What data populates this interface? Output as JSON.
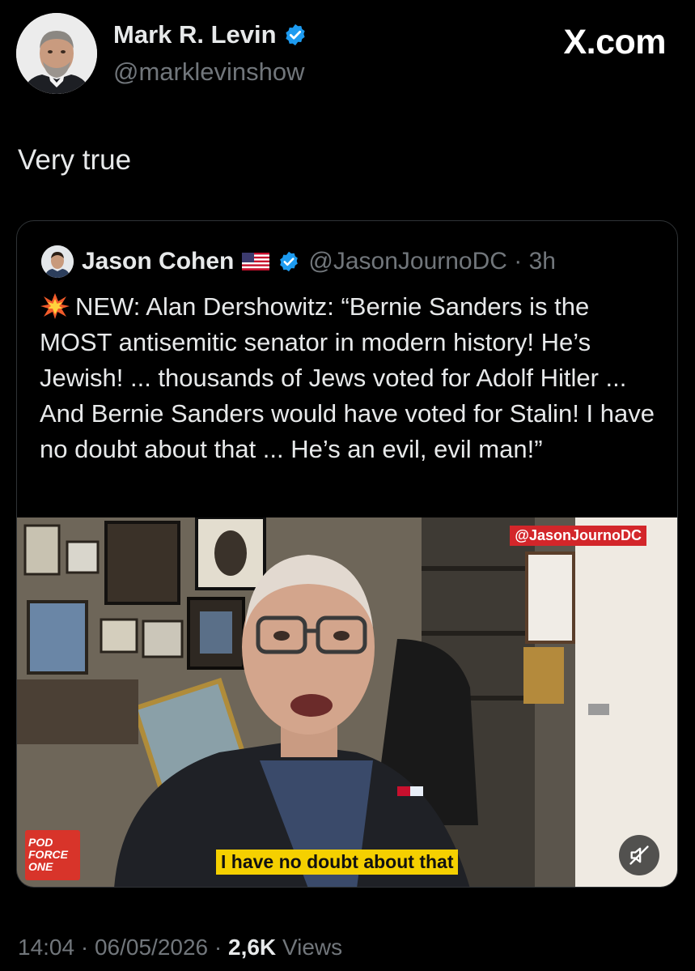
{
  "author": {
    "name": "Mark R. Levin",
    "handle": "@marklevinshow",
    "verified": true
  },
  "brand": "X.com",
  "tweet": {
    "text": "Very true"
  },
  "quote": {
    "author_name": "Jason Cohen",
    "flag": "US flag",
    "handle": "@JasonJournoDC",
    "time": "3h",
    "emoji": "collision-emoji",
    "body": "NEW: Alan Dershowitz: “Bernie Sanders is the MOST antisemitic senator in modern history! He’s Jewish! ... thousands of Jews voted for Adolf Hitler ... And Bernie Sanders would have voted for Stalin! I have no doubt about that ... He’s an evil, evil man!”",
    "video": {
      "watermark": "@JasonJournoDC",
      "caption": "I have no doubt about that",
      "logo_line1": "POD",
      "logo_line2": "FORCE",
      "logo_line3": "ONE",
      "muted": true
    }
  },
  "footer": {
    "time": "14:04",
    "date": "06/05/2026",
    "views_count": "2,6K",
    "views_label": "Views"
  },
  "colors": {
    "background": "#000000",
    "text": "#e7e9ea",
    "secondary": "#71767b",
    "verified": "#1d9bf0",
    "border": "#2f3336",
    "caption_bg": "#f5d000",
    "watermark_bg": "#d3262a"
  }
}
